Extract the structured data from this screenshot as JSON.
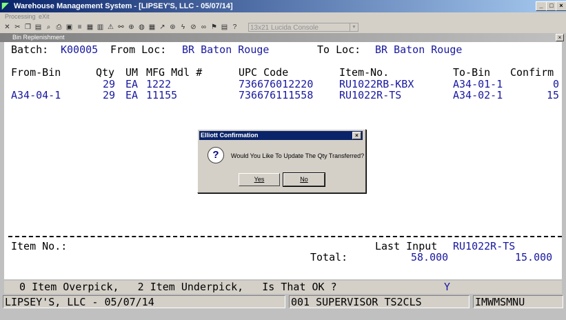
{
  "window": {
    "title": "Warehouse Management System - [LIPSEY'S, LLC - 05/07/14]",
    "minimize": "_",
    "maximize": "□",
    "close": "×"
  },
  "menu": {
    "items": [
      "Processing",
      "eXit"
    ]
  },
  "toolbar": {
    "font_box": "13x21 Lucida Console"
  },
  "child_window": {
    "title": "Bin Replenishment",
    "close": "×"
  },
  "header": {
    "batch_label": "Batch:",
    "batch_value": "K00005",
    "from_loc_label": "From Loc:",
    "from_loc_value": "BR Baton Rouge",
    "to_loc_label": "To Loc:",
    "to_loc_value": "BR Baton Rouge"
  },
  "table": {
    "columns": [
      "From-Bin",
      "Qty",
      "UM",
      "MFG Mdl #",
      "UPC Code",
      "Item-No.",
      "To-Bin",
      "Confirm"
    ],
    "rows": [
      {
        "from_bin": "",
        "qty": "29",
        "um": "EA",
        "mfg": "1222",
        "upc": "736676012220",
        "item": "RU1022RB-KBX",
        "to_bin": "A34-01-1",
        "confirm": "0"
      },
      {
        "from_bin": "A34-04-1",
        "qty": "29",
        "um": "EA",
        "mfg": "11155",
        "upc": "736676111558",
        "item": "RU1022R-TS",
        "to_bin": "A34-02-1",
        "confirm": "15"
      }
    ]
  },
  "footer": {
    "item_no_label": "Item No.:",
    "last_input_label": "Last Input",
    "last_input_value": "RU1022R-TS",
    "total_label": "Total:",
    "total_qty": "58.000",
    "total_confirm": "15.000"
  },
  "dialog": {
    "title": "Elliott Confirmation",
    "close": "×",
    "icon": "question-icon",
    "message": "Would You Like To Update The Qty Transferred?",
    "yes_label": "Yes",
    "no_label": "No"
  },
  "status": {
    "message": "  0 Item Overpick,   2 Item Underpick,   Is That OK ?",
    "answer": "Y",
    "company": "LIPSEY'S, LLC - 05/07/14",
    "user": "001 SUPERVISOR TS2CLS",
    "program": "IMWMSMNU"
  },
  "colors": {
    "title_bar": "#0a246a",
    "field_value": "#1818a0",
    "background": "#c0c0c0"
  }
}
